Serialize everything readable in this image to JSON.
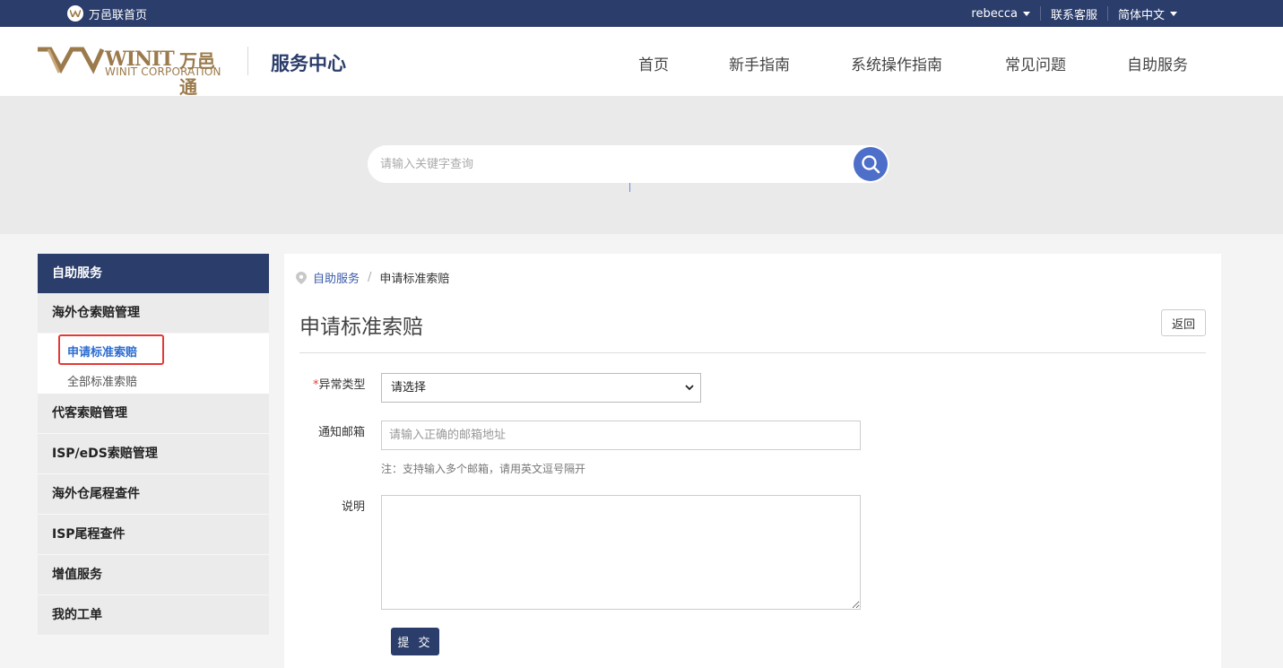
{
  "topbar": {
    "home_label": "万邑联首页",
    "user": "rebecca",
    "support": "联系客服",
    "language": "简体中文"
  },
  "header": {
    "brand_en": "WINIT",
    "brand_cn": "万邑通",
    "brand_corp": "WINIT CORPORATION",
    "title": "服务中心",
    "nav": [
      "首页",
      "新手指南",
      "系统操作指南",
      "常见问题",
      "自助服务"
    ]
  },
  "search": {
    "placeholder": "请输入关键字查询",
    "icon": "search-icon"
  },
  "sidebar": {
    "header": "自助服务",
    "groups": [
      {
        "label": "海外仓索赔管理",
        "items": [
          "申请标准索赔",
          "全部标准索赔"
        ]
      },
      {
        "label": "代客索赔管理"
      },
      {
        "label": "ISP/eDS索赔管理"
      },
      {
        "label": "海外仓尾程查件"
      },
      {
        "label": "ISP尾程查件"
      },
      {
        "label": "增值服务"
      },
      {
        "label": "我的工单"
      }
    ]
  },
  "main": {
    "breadcrumb": {
      "parent": "自助服务",
      "current": "申请标准索赔"
    },
    "title": "申请标准索赔",
    "back_label": "返回",
    "form": {
      "type_required_mark": "*",
      "type_label": "异常类型",
      "type_value": "请选择",
      "email_label": "通知邮箱",
      "email_placeholder": "请输入正确的邮箱地址",
      "email_note": "注：支持输入多个邮箱，请用英文逗号隔开",
      "desc_label": "说明",
      "submit_label": "提 交"
    }
  },
  "colors": {
    "navy": "#2b3d6b",
    "gold": "#9b7a4b",
    "search_button": "#4d6ec9",
    "highlight": "#e53935",
    "link": "#3a5ba8"
  }
}
